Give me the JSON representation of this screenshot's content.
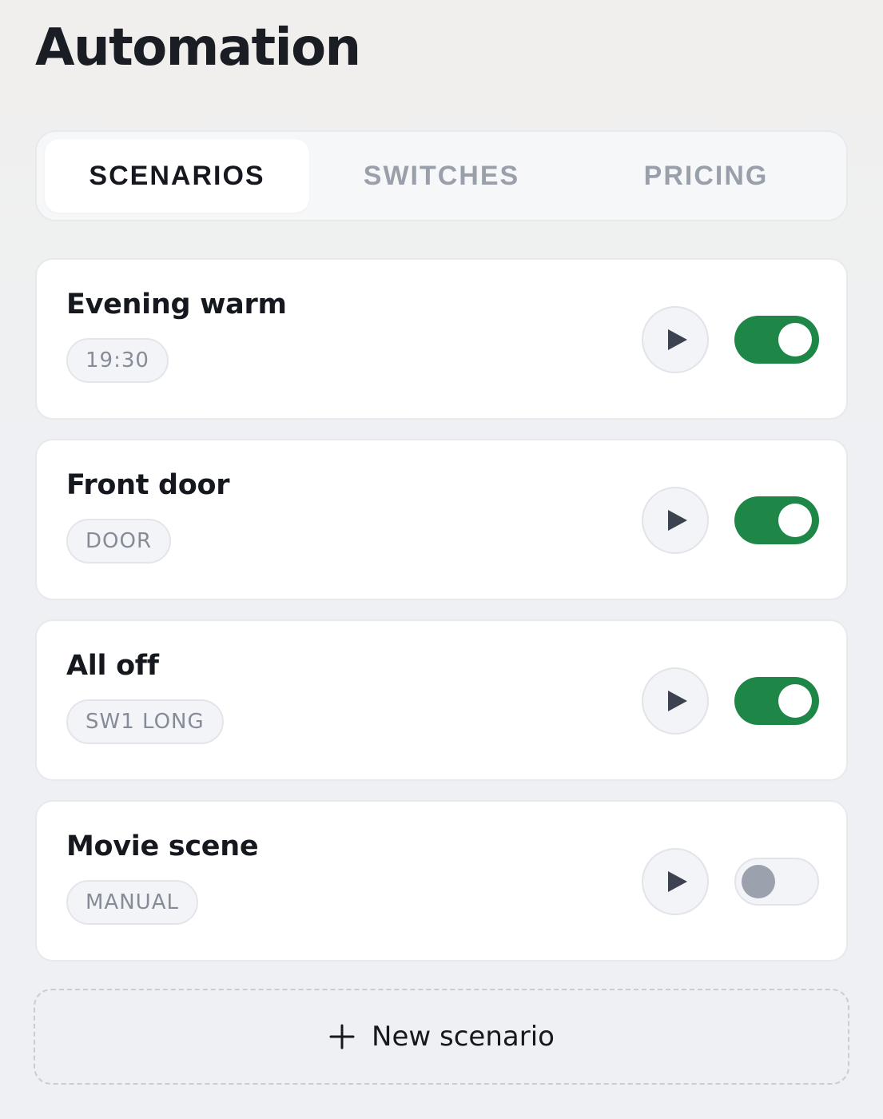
{
  "page": {
    "title": "Automation"
  },
  "tabs": [
    {
      "label": "SCENARIOS",
      "active": true
    },
    {
      "label": "SWITCHES",
      "active": false
    },
    {
      "label": "PRICING",
      "active": false
    }
  ],
  "scenarios": [
    {
      "name": "Evening warm",
      "trigger": "19:30",
      "enabled": true
    },
    {
      "name": "Front door",
      "trigger": "DOOR",
      "enabled": true
    },
    {
      "name": "All off",
      "trigger": "SW1 LONG",
      "enabled": true
    },
    {
      "name": "Movie scene",
      "trigger": "MANUAL",
      "enabled": false
    }
  ],
  "actions": {
    "new_scenario_label": "New scenario"
  },
  "icons": {
    "play": "play-icon",
    "add": "plus-icon"
  },
  "colors": {
    "toggle_on": "#1e8748",
    "toggle_off_knob": "#9ba1ad",
    "text": "#15181e"
  }
}
